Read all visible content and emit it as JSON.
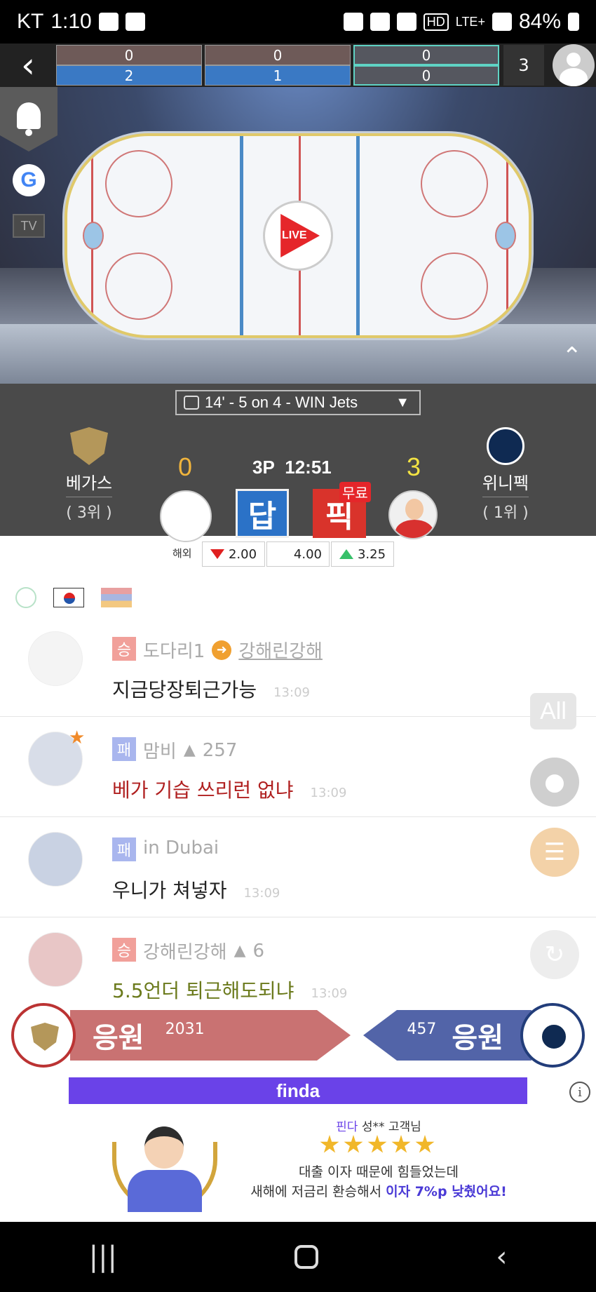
{
  "status_bar": {
    "carrier": "KT",
    "time": "1:10",
    "battery": "84%",
    "network": "LTE+",
    "icons": [
      "app-icon",
      "note-icon",
      "alarm-icon",
      "bluetooth-icon",
      "mute-icon",
      "hd-icon",
      "signal-icon",
      "battery-icon"
    ]
  },
  "score_strip": {
    "periods": [
      {
        "top": "0",
        "bottom": "2"
      },
      {
        "top": "0",
        "bottom": "1"
      },
      {
        "top": "0",
        "bottom": "0"
      }
    ],
    "total": "3"
  },
  "video": {
    "live_label": "LIVE",
    "tv_label": "TV"
  },
  "event_bar": {
    "text": "14' - 5 on 4 - WIN Jets"
  },
  "game": {
    "home": {
      "name": "베가스",
      "rank": "( 3위 )",
      "score": "0"
    },
    "away": {
      "name": "위니펙",
      "rank": "( 1위 )",
      "score": "3"
    },
    "period": "3P",
    "clock": "12:51",
    "answer_label": "답",
    "pick_label": "픽",
    "free_label": "무료"
  },
  "odds": {
    "label": "해외",
    "home": "2.00",
    "draw": "4.00",
    "away": "3.25"
  },
  "chat": [
    {
      "result": "승",
      "nick": "도다리1",
      "target": "강해린강해",
      "text": "지금당장퇴근가능",
      "time": "13:09"
    },
    {
      "result": "패",
      "nick": "맘비",
      "likes": "257",
      "text": "베가 기습 쓰리런 없냐",
      "time": "13:09",
      "text_color": "#b02020"
    },
    {
      "result": "패",
      "nick": "in Dubai",
      "text": "우니가 쳐넣자",
      "time": "13:09"
    },
    {
      "result": "승",
      "nick": "강해린강해",
      "likes": "6",
      "text": "5.5언더 퇴근해도되냐",
      "time": "13:09",
      "text_color": "#6b7a1c"
    }
  ],
  "fabs": {
    "all_label": "All"
  },
  "cheer": {
    "label": "응원",
    "home_count": "2031",
    "away_count": "457"
  },
  "ad": {
    "brand": "finda",
    "reviewer_brand": "핀다",
    "reviewer": "성** 고객님",
    "line1": "대출 이자 때문에 힘들었는데",
    "line2_prefix": "새해에 저금리 환승해서",
    "line2_highlight": "이자 7%p 낮췄어요!",
    "star_count": 5
  }
}
